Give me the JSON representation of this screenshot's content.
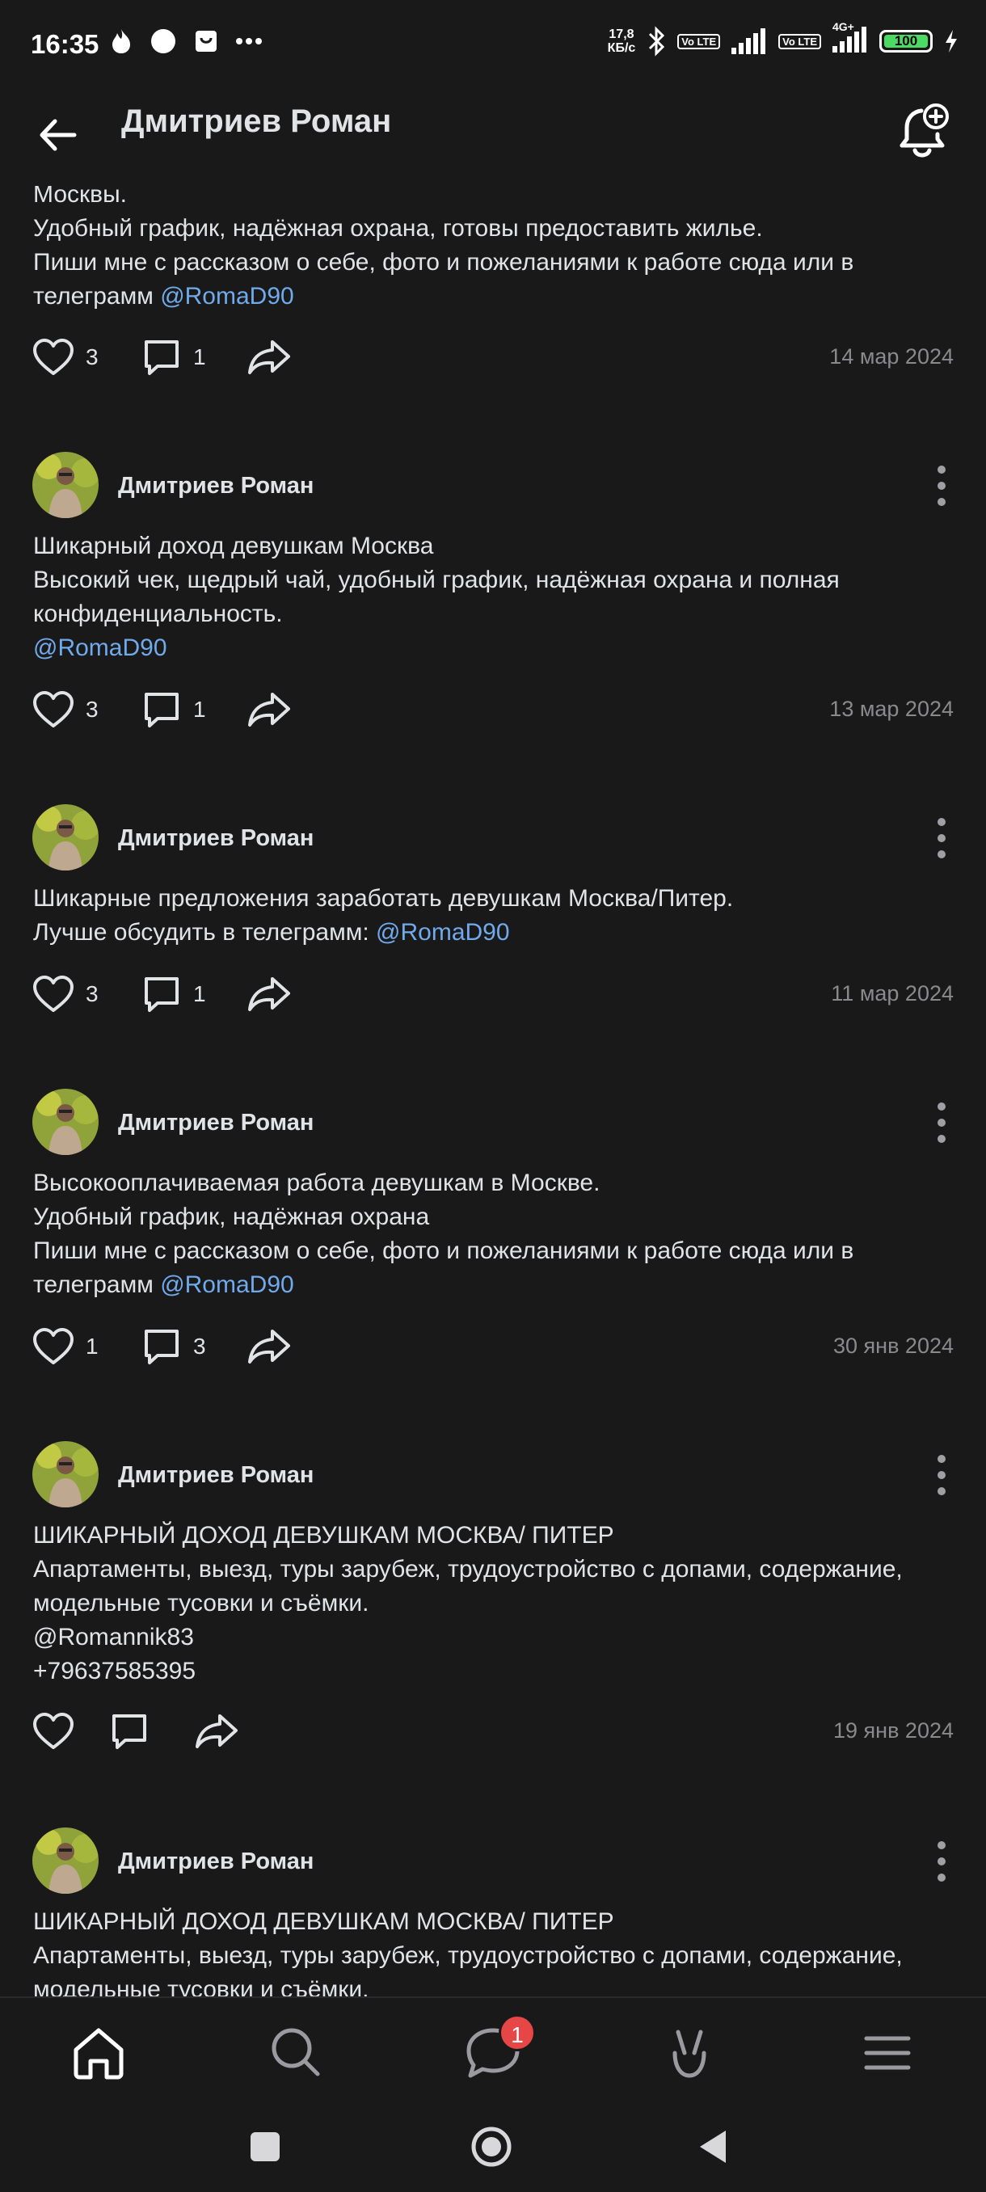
{
  "status_bar": {
    "time": "16:35",
    "speed_value": "17,8",
    "speed_unit": "КБ/с",
    "sim1": "Vo LTE",
    "sim2": "Vo LTE",
    "network": "4G+",
    "battery": "100",
    "colors": {
      "battery": "#4cd964"
    }
  },
  "header": {
    "title": "Дмитриев Роман"
  },
  "posts": [
    {
      "author": "",
      "lines": [
        {
          "text": "Москвы."
        },
        {
          "text": "Удобный график, надёжная охрана, готовы предоставить жилье."
        },
        {
          "text": "Пиши мне с рассказом о себе, фото и пожеланиями к работе сюда или в"
        },
        {
          "text": "телеграмм ",
          "link": "@RomaD90"
        }
      ],
      "likes": "3",
      "comments": "1",
      "date": "14 мар 2024"
    },
    {
      "author": "Дмитриев Роман",
      "lines": [
        {
          "text": "Шикарный доход девушкам Москва"
        },
        {
          "text": "Высокий чек, щедрый чай, удобный график, надёжная охрана и полная"
        },
        {
          "text": "конфиденциальность."
        },
        {
          "text": "",
          "link": "@RomaD90"
        }
      ],
      "likes": "3",
      "comments": "1",
      "date": "13 мар 2024"
    },
    {
      "author": "Дмитриев Роман",
      "lines": [
        {
          "text": "Шикарные предложения заработать девушкам Москва/Питер."
        },
        {
          "text": "Лучше обсудить в телеграмм: ",
          "link": "@RomaD90"
        }
      ],
      "likes": "3",
      "comments": "1",
      "date": "11 мар 2024"
    },
    {
      "author": "Дмитриев Роман",
      "lines": [
        {
          "text": "Высокооплачиваемая работа девушкам в Москве."
        },
        {
          "text": "Удобный график, надёжная охрана"
        },
        {
          "text": "Пиши мне с рассказом о себе, фото и пожеланиями к работе сюда или в"
        },
        {
          "text": "телеграмм ",
          "link": "@RomaD90"
        }
      ],
      "likes": "1",
      "comments": "3",
      "date": "30 янв 2024"
    },
    {
      "author": "Дмитриев Роман",
      "lines": [
        {
          "text": "ШИКАРНЫЙ ДОХОД ДЕВУШКАМ МОСКВА/ ПИТЕР"
        },
        {
          "text": "Апартаменты, выезд, туры зарубеж, трудоустройство с допами, содержание,"
        },
        {
          "text": "модельные тусовки и съёмки."
        },
        {
          "text": "@Romannik83"
        },
        {
          "text": "+79637585395"
        }
      ],
      "likes": "",
      "comments": "",
      "date": "19 янв 2024"
    },
    {
      "author": "Дмитриев Роман",
      "lines": [
        {
          "text": "ШИКАРНЫЙ ДОХОД ДЕВУШКАМ МОСКВА/ ПИТЕР"
        },
        {
          "text": "Апартаменты, выезд, туры зарубеж, трудоустройство с допами, содержание,"
        },
        {
          "text": "модельные тусовки и съёмки."
        }
      ],
      "likes": "",
      "comments": "",
      "date": ""
    }
  ],
  "bottom_nav": {
    "items": [
      {
        "icon": "home-icon"
      },
      {
        "icon": "search-icon"
      },
      {
        "icon": "messages-icon"
      },
      {
        "icon": "clips-icon"
      },
      {
        "icon": "menu-icon"
      }
    ],
    "messages_badge": "1",
    "colors": {
      "badge": "#e64646",
      "link": "#71aaeb"
    }
  }
}
